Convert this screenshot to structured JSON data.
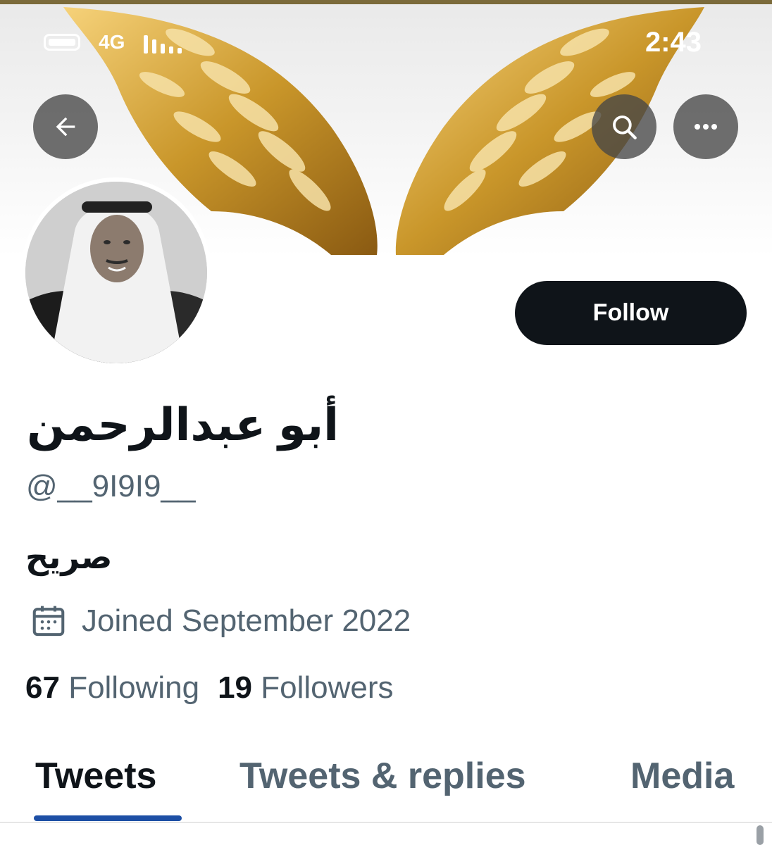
{
  "status_bar": {
    "network": "4G",
    "time": "2:43"
  },
  "header": {
    "back_icon": "arrow-left-icon",
    "search_icon": "search-icon",
    "more_icon": "more-horizontal-icon"
  },
  "profile": {
    "display_name": "أبو عبدالرحمن",
    "handle": "@__9I9I9__",
    "bio": "صريح",
    "joined": "Joined September 2022",
    "joined_icon": "calendar-icon",
    "following_count": "67",
    "following_label": "Following",
    "followers_count": "19",
    "followers_label": "Followers"
  },
  "actions": {
    "follow_label": "Follow"
  },
  "tabs": [
    {
      "label": "Tweets",
      "active": true
    },
    {
      "label": "Tweets & replies",
      "active": false
    },
    {
      "label": "Media",
      "active": false
    }
  ],
  "colors": {
    "primary_text": "#0f1419",
    "secondary_text": "#536471",
    "follow_button_bg": "#0f1419",
    "tab_indicator": "#1d4fa5",
    "wing_gold": "#c9962a"
  }
}
